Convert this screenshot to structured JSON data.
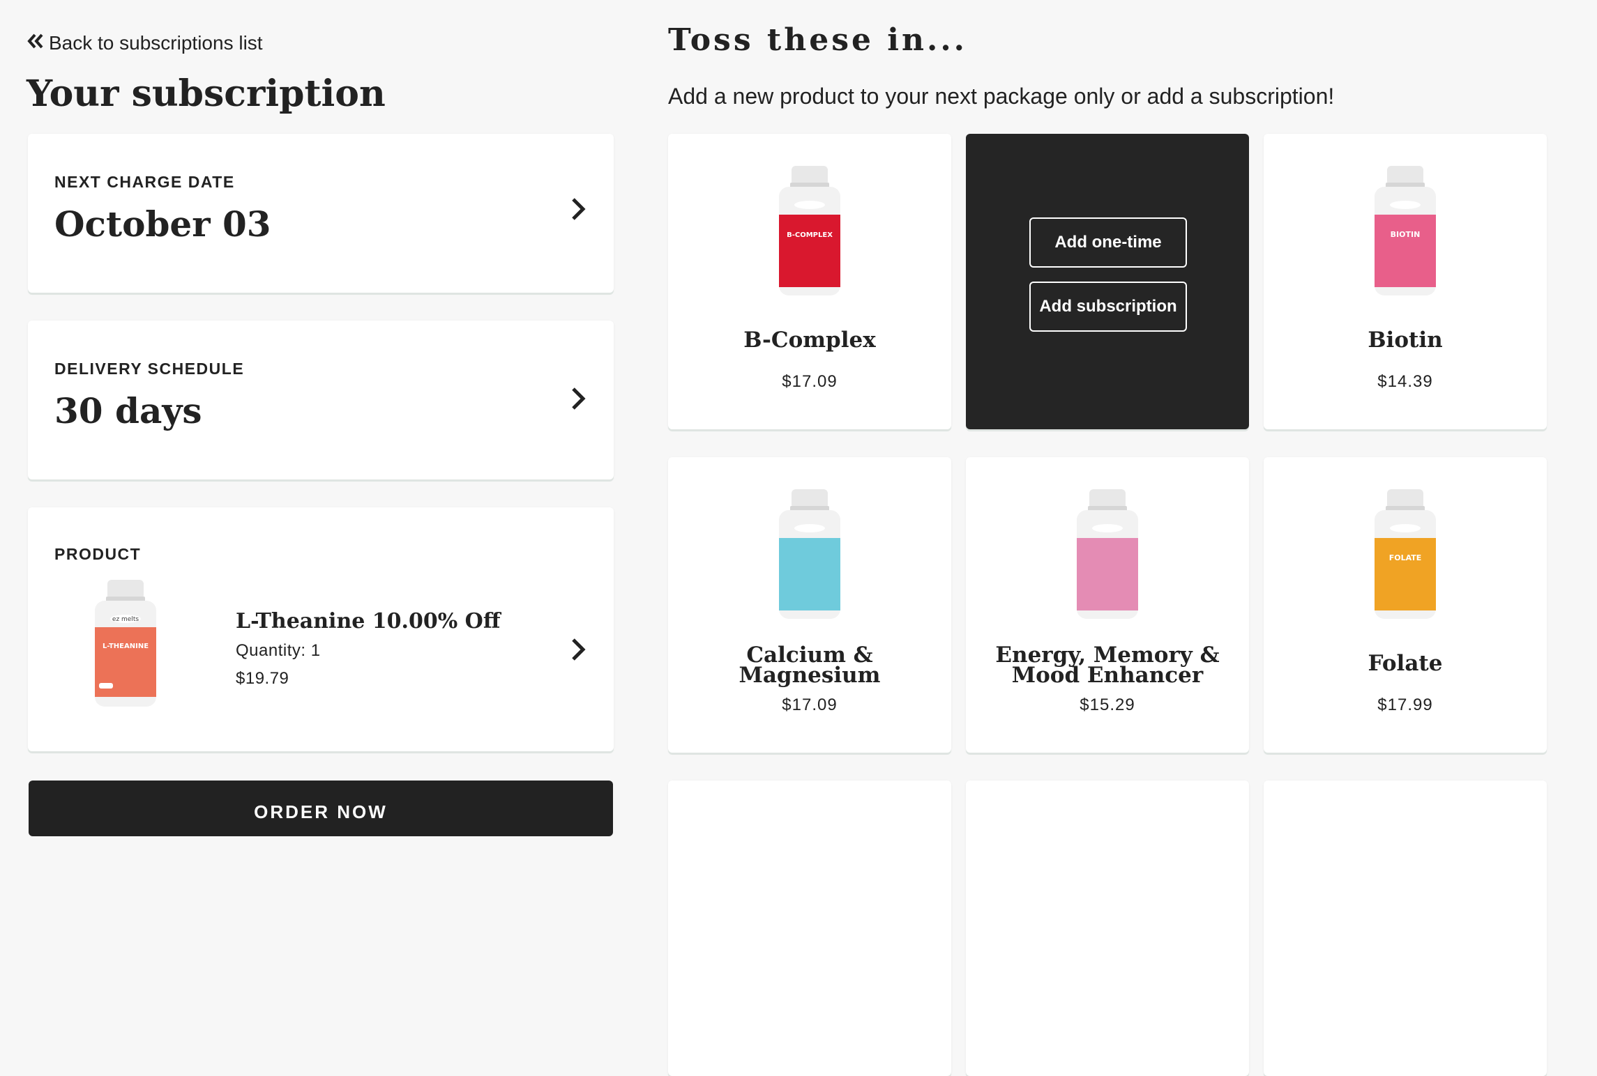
{
  "back_link": {
    "label": "Back to subscriptions list"
  },
  "page_title": "Your subscription",
  "next_charge": {
    "label": "NEXT CHARGE DATE",
    "value": "October 03"
  },
  "delivery": {
    "label": "DELIVERY SCHEDULE",
    "value": "30 days"
  },
  "product": {
    "label": "PRODUCT",
    "name": "L-Theanine 10.00% Off",
    "quantity": "Quantity: 1",
    "price": "$19.79",
    "bottle_color": "#ec7257",
    "brand": "ez melts",
    "bottle_text": "L-THEANINE"
  },
  "order_button": "ORDER NOW",
  "addons": {
    "title": "Toss these in...",
    "subtitle": "Add a new product to your next package only or add a subscription!",
    "overlay": {
      "one_time": "Add one-time",
      "subscription": "Add subscription"
    },
    "products": [
      {
        "name": "B-Complex",
        "price": "$17.09",
        "color": "#d9182e",
        "label": "B-COMPLEX"
      },
      {
        "name": "",
        "price": "",
        "color": "#3fb6c9",
        "label": ""
      },
      {
        "name": "Biotin",
        "price": "$14.39",
        "color": "#e85f8a",
        "label": "BIOTIN"
      },
      {
        "name": "Calcium & Magnesium",
        "name_line1": "Calcium &",
        "name_line2": "Magnesium",
        "price": "$17.09",
        "color": "#6fcbdc",
        "label": "CALCIUM & MAGNESIUM"
      },
      {
        "name": "Energy, Memory & Mood Enhancer",
        "name_line1": "Energy, Memory &",
        "name_line2": "Mood Enhancer",
        "price": "$15.29",
        "color": "#e48cb4",
        "label": "ENERGY, MEMORY & MOOD ENHANCER"
      },
      {
        "name": "Folate",
        "price": "$17.99",
        "color": "#f0a324",
        "label": "FOLATE"
      }
    ]
  }
}
